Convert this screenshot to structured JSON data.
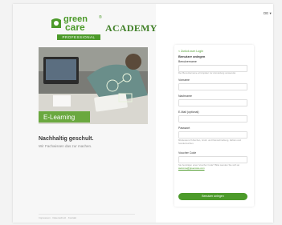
{
  "brand": {
    "line1": "green",
    "line2": "care",
    "reg": "®",
    "academy": "ACADEMY",
    "tag": "PROFESSIONAL"
  },
  "hero": {
    "banner_label": "E-Learning"
  },
  "left": {
    "headline": "Nachhaltig geschult.",
    "subline": "Wir Fachwissen das zur machen.",
    "footer": "Impressum · Datenschutz · Kontakt"
  },
  "lang": "DE ▾",
  "form": {
    "back": "< Zurück zum Login",
    "title": "Benutzer anlegen",
    "username_label": "Benutzername",
    "username_hint": "Der Benutzername wird später zur Anmeldung verwendet.",
    "firstname_label": "Vorname",
    "lastname_label": "Nachname",
    "email_label": "E-Mail (optional)",
    "password_label": "Passwort",
    "password_hint": "Mindestens 8 Zeichen, Groß- und Kleinschreibung, Zahlen und Sonderzeichen.",
    "voucher_label": "Voucher Code",
    "voucher_hint_pre": "Sie benötigen einen Voucher Code? Bitte wenden Sie sich an",
    "voucher_email": "welcome@greencare.com",
    "submit": "Benutzer anlegen"
  },
  "colors": {
    "brand_green": "#4c9a2a"
  }
}
